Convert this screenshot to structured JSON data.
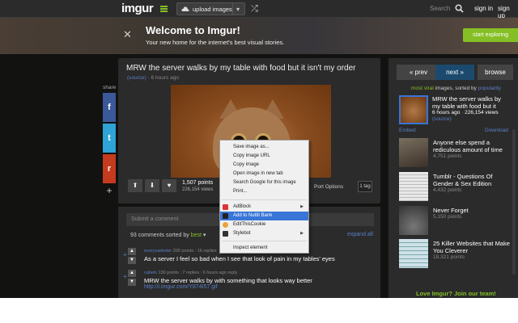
{
  "header": {
    "logo": "imgur",
    "upload_label": "upload images",
    "search_label": "Search",
    "signin": "sign in",
    "signup": "sign up"
  },
  "banner": {
    "title": "Welcome to Imgur!",
    "subtitle": "Your new home for the internet's best visual stories.",
    "cta": "start exploring"
  },
  "share": {
    "label": "share",
    "facebook": "f",
    "twitter": "t",
    "reddit": "r",
    "more": "+"
  },
  "post": {
    "title": "MRW the server walks by my table with food but it isn't my order",
    "source": "(source)",
    "time": "· 6 hours ago",
    "points": "1,507 points",
    "views": "226,154 views",
    "port_options": "Port Options",
    "flag": "1 tag"
  },
  "comments": {
    "submit_placeholder": "Submit a comment",
    "count_text": "93 comments sorted by",
    "sort": "best",
    "expand": "expand all",
    "items": [
      {
        "user": "everyvasketer",
        "meta": "200 points : 16 replies",
        "text": "As a server I feel so bad when I see that look of pain in my tables' eyes"
      },
      {
        "user": "cabels",
        "meta": "130 points : 7 replies : 6 hours ago reply",
        "text": "MRW the server walks by with something that looks way better",
        "link": "http://i.imgur.com/Y874I57.gif"
      }
    ]
  },
  "sidebar": {
    "prev": "« prev",
    "next": "next »",
    "browse": "browse",
    "viral_prefix": "most viral",
    "viral_mid": "images, sorted by",
    "viral_sort": "popularity",
    "featured": {
      "title": "MRW the server walks by my table with food but it",
      "time": "6 hours ago",
      "views": "226,154 views",
      "source": "(source)"
    },
    "embed": "Embed",
    "download": "Download",
    "items": [
      {
        "title": "Anyone else spend a rediculous amount of time",
        "count": "4,751 points"
      },
      {
        "title": "Tumblr - Questions Of Gender & Sex Edition",
        "count": "4,432 points"
      },
      {
        "title": "Never Forget",
        "count": "5,150 points"
      },
      {
        "title": "25 Killer Websites that Make You Cleverer",
        "count": "18,321 points"
      }
    ],
    "join": "Love Imgur? Join our team!"
  },
  "context_menu": {
    "items": [
      "Save image as...",
      "Copy image URL",
      "Copy image",
      "Open image in new tab",
      "Search Google for this image",
      "Print..."
    ],
    "ext_items": [
      "AdBlock",
      "Add to Nuttit Bank",
      "EditThisCookie",
      "Stylebot"
    ],
    "inspect": "Inspect element"
  },
  "colors": {
    "accent_green": "#85bf25",
    "link_blue": "#5a7fc8",
    "bg": "#121211",
    "panel": "#2b2b2b",
    "highlight": "#3875d7"
  }
}
